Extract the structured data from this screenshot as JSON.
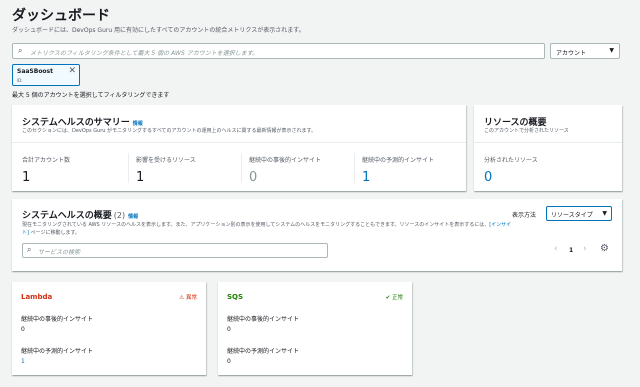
{
  "page": {
    "title": "ダッシュボード",
    "subtitle": "ダッシュボードには、DevOps Guru 用に有効にしたすべてのアカウントの統合メトリクスが表示されます。"
  },
  "filter": {
    "placeholder": "メトリクスのフィルタリング条件として最大 5 個の AWS アカウントを選択します。",
    "account_select": "アカウント",
    "token_name": "SaaSBoost",
    "token_id": "ID:",
    "note": "最大 5 個のアカウントを選択してフィルタリングできます"
  },
  "summary": {
    "title": "システムヘルスのサマリー",
    "info": "情報",
    "desc": "このセクションには、DevOps Guru がモニタリングするすべてのアカウントの運用上のヘルスに関する最新情報が表示されます。",
    "stats": [
      {
        "label": "合計アカウント数",
        "value": "1"
      },
      {
        "label": "影響を受けるリソース",
        "value": "1"
      },
      {
        "label": "継続中の事後的インサイト",
        "value": "0"
      },
      {
        "label": "継続中の予測的インサイト",
        "value": "1"
      }
    ]
  },
  "resources": {
    "title": "リソースの概要",
    "desc": "このアカウントで分析されたリソース",
    "label": "分析されたリソース",
    "value": "0"
  },
  "overview": {
    "title": "システムヘルスの概要",
    "count": "(2)",
    "info": "情報",
    "desc": "現在モニタリングされている AWS リソースのヘルスを表示します。また、アプリケーション別の表示を使用してシステムのヘルスをモニタリングすることもできます。リソースのインサイトを表示するには、",
    "link": "[インサイト]",
    "desc_tail": " ページに移動します。",
    "display_label": "表示方法",
    "display_value": "リソースタイプ",
    "search_placeholder": "サービスの検索",
    "page": "1"
  },
  "services": [
    {
      "name": "Lambda",
      "status": "異常",
      "reactive_label": "継続中の事後的インサイト",
      "reactive_value": "0",
      "proactive_label": "継続中の予測的インサイト",
      "proactive_value": "1"
    },
    {
      "name": "SQS",
      "status": "正常",
      "reactive_label": "継続中の事後的インサイト",
      "reactive_value": "0",
      "proactive_label": "継続中の予測的インサイト",
      "proactive_value": "0"
    }
  ],
  "colors": {
    "link": "#0073bb",
    "alarm": "#d13212",
    "ok": "#1d8102"
  },
  "icons": [
    "search-icon",
    "close-icon",
    "caret-down-icon",
    "warning-icon",
    "check-circle-icon",
    "chevron-left-icon",
    "chevron-right-icon",
    "gear-icon"
  ]
}
